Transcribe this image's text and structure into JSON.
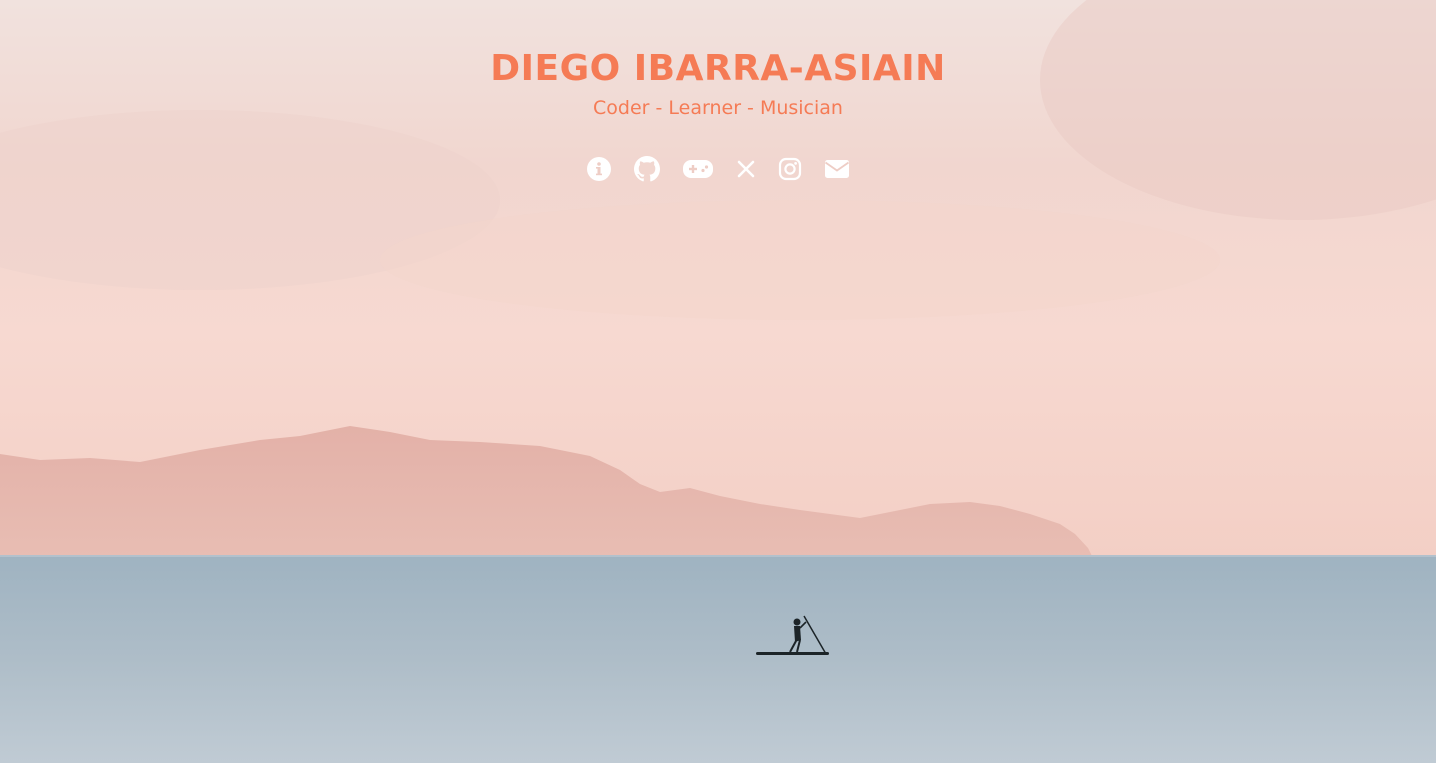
{
  "header": {
    "title": "DIEGO IBARRA-ASIAIN",
    "tagline": "Coder - Learner - Musician"
  },
  "social_links": [
    {
      "icon": "info-circle-icon",
      "name": "about-link"
    },
    {
      "icon": "github-icon",
      "name": "github-link"
    },
    {
      "icon": "gamepad-icon",
      "name": "games-link"
    },
    {
      "icon": "x-twitter-icon",
      "name": "x-link"
    },
    {
      "icon": "instagram-icon",
      "name": "instagram-link"
    },
    {
      "icon": "envelope-icon",
      "name": "email-link"
    }
  ],
  "colors": {
    "accent": "#f57b55",
    "icon": "#ffffff",
    "sky": "#f3d8d0",
    "sea": "#a9b9c4",
    "mountains": "#e6b4ab"
  }
}
